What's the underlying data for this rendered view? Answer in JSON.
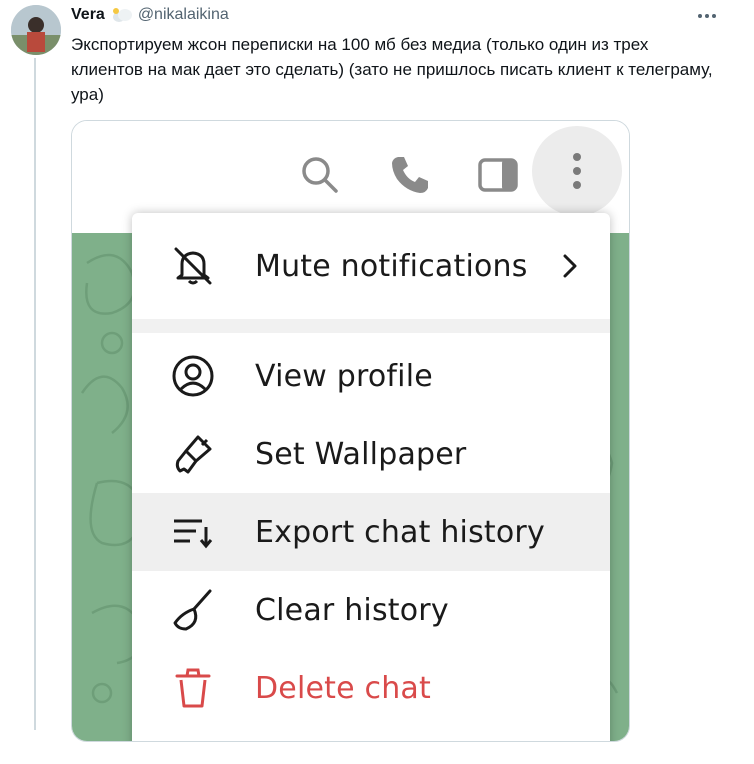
{
  "tweet": {
    "author_name": "Vera",
    "handle": "@nikalaikina",
    "badge_icon": "cloud-emoji-icon",
    "text": "Экспортируем жсон переписки на 100 мб без медиа (только один из трех клиентов на мак дает это сделать) (зато не пришлось писать клиент к телеграму, ура)",
    "more_icon": "more-dots-icon"
  },
  "screenshot": {
    "header_icons": [
      "search-icon",
      "phone-icon",
      "sidebar-toggle-icon",
      "vertical-dots-icon"
    ],
    "menu": {
      "items": [
        {
          "label": "Mute notifications",
          "icon": "mute-bell-icon",
          "has_submenu": true
        },
        {
          "label": "View profile",
          "icon": "profile-icon"
        },
        {
          "label": "Set Wallpaper",
          "icon": "brush-icon"
        },
        {
          "label": "Export chat history",
          "icon": "sort-list-icon",
          "highlighted": true
        },
        {
          "label": "Clear history",
          "icon": "broom-icon"
        },
        {
          "label": "Delete chat",
          "icon": "trash-icon",
          "danger": true
        }
      ]
    }
  },
  "colors": {
    "chat_background": "#7fb08a",
    "danger": "#d94a4a",
    "highlight": "#efefef"
  }
}
